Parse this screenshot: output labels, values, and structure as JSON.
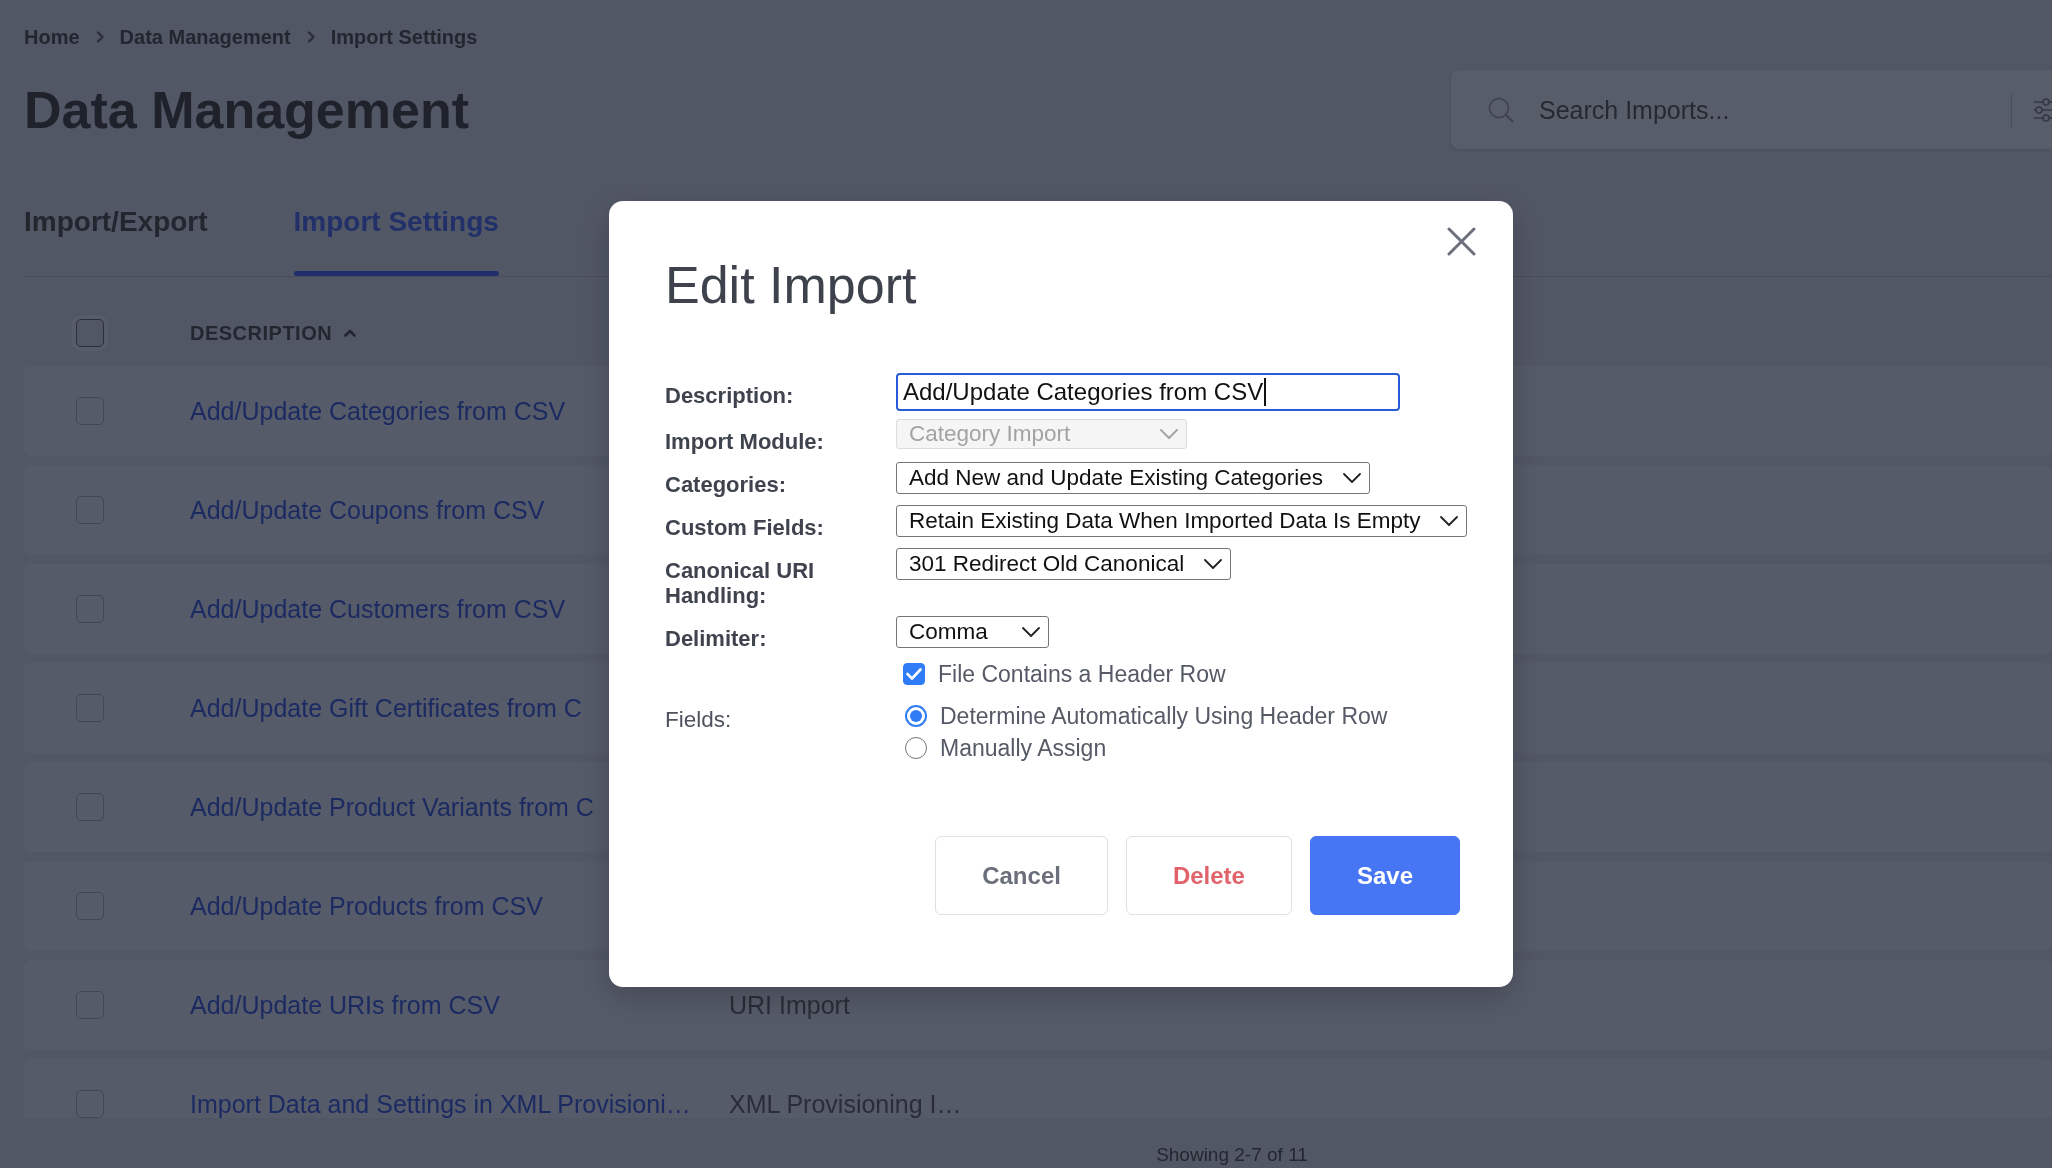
{
  "breadcrumb": [
    {
      "label": "Home"
    },
    {
      "label": "Data Management"
    },
    {
      "label": "Import Settings"
    }
  ],
  "page_title": "Data Management",
  "search": {
    "placeholder": "Search Imports..."
  },
  "tabs": [
    {
      "label": "Import/Export",
      "selected": false
    },
    {
      "label": "Import Settings",
      "selected": true
    }
  ],
  "table": {
    "select_all": {
      "checked": false
    },
    "columns": [
      {
        "label": "DESCRIPTION",
        "sorted": true,
        "descending": false
      }
    ],
    "rows": [
      {
        "checked": false,
        "description": "Add/Update Categories from CSV"
      },
      {
        "checked": false,
        "description": "Add/Update Coupons from CSV"
      },
      {
        "checked": false,
        "description": "Add/Update Customers from CSV"
      },
      {
        "checked": false,
        "description": "Add/Update Gift Certificates from C"
      },
      {
        "checked": false,
        "description": "Add/Update Product Variants from C"
      },
      {
        "checked": false,
        "description": "Add/Update Products from CSV"
      },
      {
        "checked": false,
        "description": "Add/Update URIs from CSV",
        "module": "URI Import"
      },
      {
        "checked": false,
        "description": "Import Data and Settings in XML Provisioni…",
        "module": "XML Provisioning I…"
      }
    ]
  },
  "pagination": {
    "summary": "Showing 2-7 of 11"
  },
  "dialog": {
    "title": "Edit Import",
    "fields": [
      {
        "kind": "text",
        "label": "Description:",
        "value": "Add/Update Categories from CSV",
        "focused": true,
        "disabled": false
      },
      {
        "kind": "select",
        "label": "Import Module:",
        "value": "Category Import",
        "focused": false,
        "disabled": true
      },
      {
        "kind": "select",
        "label": "Categories:",
        "value": "Add New and Update Existing Categories",
        "focused": false,
        "disabled": false
      },
      {
        "kind": "select",
        "label": "Custom Fields:",
        "value": "Retain Existing Data When Imported Data Is Empty",
        "focused": false,
        "disabled": false
      },
      {
        "kind": "select",
        "label": "Canonical URI Handling:",
        "value": "301 Redirect Old Canonical",
        "focused": false,
        "disabled": false
      },
      {
        "kind": "select",
        "label": "Delimiter:",
        "value": "Comma",
        "focused": false,
        "disabled": false
      },
      {
        "kind": "checkbox",
        "label": "File Contains a Header Row",
        "checked": true
      },
      {
        "kind": "radio_group",
        "label": "Fields:",
        "options": [
          {
            "label": "Determine Automatically Using Header Row",
            "selected": true
          },
          {
            "label": "Manually Assign",
            "selected": false
          }
        ]
      }
    ],
    "buttons": [
      {
        "label": "Cancel",
        "kind": "secondary"
      },
      {
        "label": "Delete",
        "kind": "danger"
      },
      {
        "label": "Save",
        "kind": "primary"
      }
    ]
  }
}
